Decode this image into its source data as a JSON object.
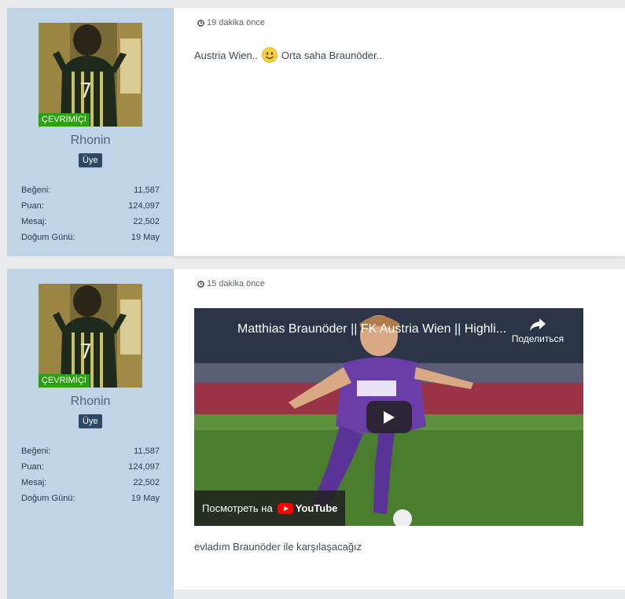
{
  "posts": [
    {
      "user": {
        "status": "ÇEVRİMİÇİ",
        "name": "Rhonin",
        "role": "Üye",
        "stats": [
          {
            "label": "Beğeni:",
            "value": "11,587"
          },
          {
            "label": "Puan:",
            "value": "124,097"
          },
          {
            "label": "Mesaj:",
            "value": "22,502"
          },
          {
            "label": "Doğum Günü:",
            "value": "19 May"
          }
        ]
      },
      "timestamp": "19 dakika önce",
      "message_before": "Austria Wien..",
      "message_after": "Orta saha Braunöder.."
    },
    {
      "user": {
        "status": "ÇEVRİMİÇİ",
        "name": "Rhonin",
        "role": "Üye",
        "stats": [
          {
            "label": "Beğeni:",
            "value": "11,587"
          },
          {
            "label": "Puan:",
            "value": "124,097"
          },
          {
            "label": "Mesaj:",
            "value": "22,502"
          },
          {
            "label": "Doğum Günü:",
            "value": "19 May"
          }
        ]
      },
      "timestamp": "15 dakika önce",
      "video": {
        "title": "Matthias Braunöder || FK Austria Wien || Highli...",
        "share_label": "Поделиться",
        "watch_on": "Посмотреть на",
        "brand": "YouTube"
      },
      "caption": "evladım Braunöder ile karşılaşacağız"
    }
  ],
  "colors": {
    "user_panel": "#c0d4e8",
    "online_badge": "#2aa10f",
    "role_badge": "#2e4863",
    "youtube_red": "#ff0000"
  }
}
